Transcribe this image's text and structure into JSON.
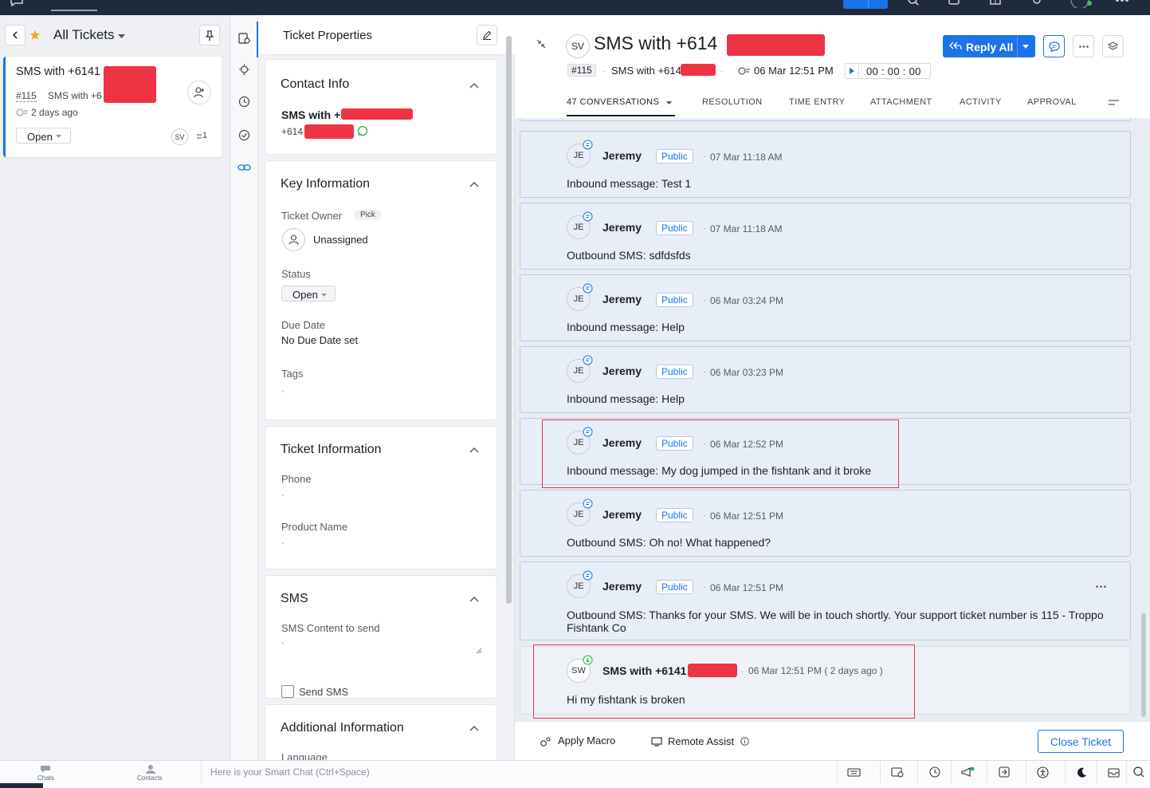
{
  "left_panel": {
    "view_title": "All Tickets",
    "ticket": {
      "subject": "SMS with +6141",
      "number": "#115",
      "summary": "SMS with +6",
      "age": "2 days ago",
      "status": "Open",
      "owner_initials": "SV",
      "count": "1"
    }
  },
  "properties": {
    "header": "Ticket Properties",
    "contact_info": {
      "title": "Contact Info",
      "name": "SMS with +6",
      "phone": "+614"
    },
    "key_info": {
      "title": "Key Information",
      "owner_label": "Ticket Owner",
      "pick_label": "Pick",
      "owner_value": "Unassigned",
      "status_label": "Status",
      "status_value": "Open",
      "due_label": "Due Date",
      "due_value": "No Due Date set",
      "tags_label": "Tags",
      "tags_value": "-"
    },
    "ticket_info": {
      "title": "Ticket Information",
      "phone_label": "Phone",
      "phone_value": "-",
      "product_label": "Product Name",
      "product_value": "-"
    },
    "sms": {
      "title": "SMS",
      "content_label": "SMS Content to send",
      "content_value": "-",
      "send_label": "Send SMS"
    },
    "additional": {
      "title": "Additional Information",
      "language_label": "Language"
    }
  },
  "main": {
    "assignee_initials": "SV",
    "title": "SMS with +614",
    "ticket_number": "#115",
    "subtitle": "SMS with +614",
    "created": "06 Mar 12:51 PM",
    "timer": "00 : 00 : 00",
    "reply_all": "Reply All",
    "tabs": [
      "47 CONVERSATIONS",
      "RESOLUTION",
      "TIME ENTRY",
      "ATTACHMENT",
      "ACTIVITY",
      "APPROVAL"
    ],
    "messages": [
      {
        "initials": "JE",
        "author": "Jeremy",
        "visibility": "Public",
        "time": "07 Mar 11:18 AM",
        "body": "Inbound message: Test 1"
      },
      {
        "initials": "JE",
        "author": "Jeremy",
        "visibility": "Public",
        "time": "07 Mar 11:18 AM",
        "body": "Outbound SMS: sdfdsfds"
      },
      {
        "initials": "JE",
        "author": "Jeremy",
        "visibility": "Public",
        "time": "06 Mar 03:24 PM",
        "body": "Inbound message: Help"
      },
      {
        "initials": "JE",
        "author": "Jeremy",
        "visibility": "Public",
        "time": "06 Mar 03:23 PM",
        "body": "Inbound message: Help"
      },
      {
        "initials": "JE",
        "author": "Jeremy",
        "visibility": "Public",
        "time": "06 Mar 12:52 PM",
        "body": "Inbound message: My dog jumped in the fishtank and it broke"
      },
      {
        "initials": "JE",
        "author": "Jeremy",
        "visibility": "Public",
        "time": "06 Mar 12:51 PM",
        "body": "Outbound SMS: Oh no! What happened?"
      },
      {
        "initials": "JE",
        "author": "Jeremy",
        "visibility": "Public",
        "time": "06 Mar 12:51 PM",
        "body": "Outbound SMS: Thanks for your SMS. We will be in touch shortly. Your support ticket number is 115 - Troppo Fishtank Co"
      }
    ],
    "incoming": {
      "initials": "SW",
      "author": "SMS with +6141",
      "time": "06 Mar 12:51 PM ( 2 days ago )",
      "body": "Hi my fishtank is broken"
    },
    "footer": {
      "apply_macro": "Apply Macro",
      "remote_assist": "Remote Assist",
      "close_ticket": "Close Ticket"
    }
  },
  "bottom_bar": {
    "chats": "Chats",
    "contacts": "Contacts",
    "smart_chat_placeholder": "Here is your Smart Chat (Ctrl+Space)"
  },
  "colors": {
    "accent": "#1a73e8",
    "redaction": "#ee3344",
    "highlight_box": "#e53945",
    "message_bg": "#e8eef8"
  }
}
